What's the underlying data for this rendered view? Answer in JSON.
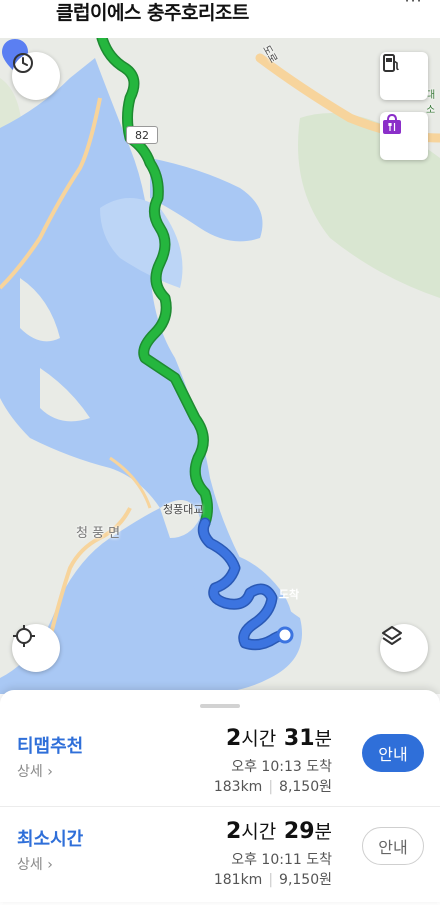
{
  "header": {
    "title": "클럽이에스 충주호리조트",
    "menu_icon": "more-dots-icon"
  },
  "map": {
    "road_number": "82",
    "labels": {
      "bridge": "청풍대교",
      "town": "청 풍 면",
      "road_partial": "도로",
      "edge_partial": "대소"
    },
    "destination_label": "도착",
    "colors": {
      "route_green": "#25b63e",
      "route_blue": "#3c74e0",
      "water": "#a9c8f4",
      "land": "#e9ebe6",
      "road_orange": "#f7d49c"
    },
    "buttons": {
      "history": "clock-icon",
      "gas": "gas-station-icon",
      "food": "food-icon",
      "locate": "crosshair-icon",
      "layers": "layers-icon"
    }
  },
  "routes": [
    {
      "name": "티맵추천",
      "detail": "상세",
      "time_h": "2",
      "time_h_unit": "시간",
      "time_m": "31",
      "time_m_unit": "분",
      "arrive": "오후 10:13 도착",
      "distance": "183km",
      "toll": "8,150원",
      "button": "안내"
    },
    {
      "name": "최소시간",
      "detail": "상세",
      "time_h": "2",
      "time_h_unit": "시간",
      "time_m": "29",
      "time_m_unit": "분",
      "arrive": "오후 10:11 도착",
      "distance": "181km",
      "toll": "9,150원",
      "button": "안내"
    }
  ]
}
